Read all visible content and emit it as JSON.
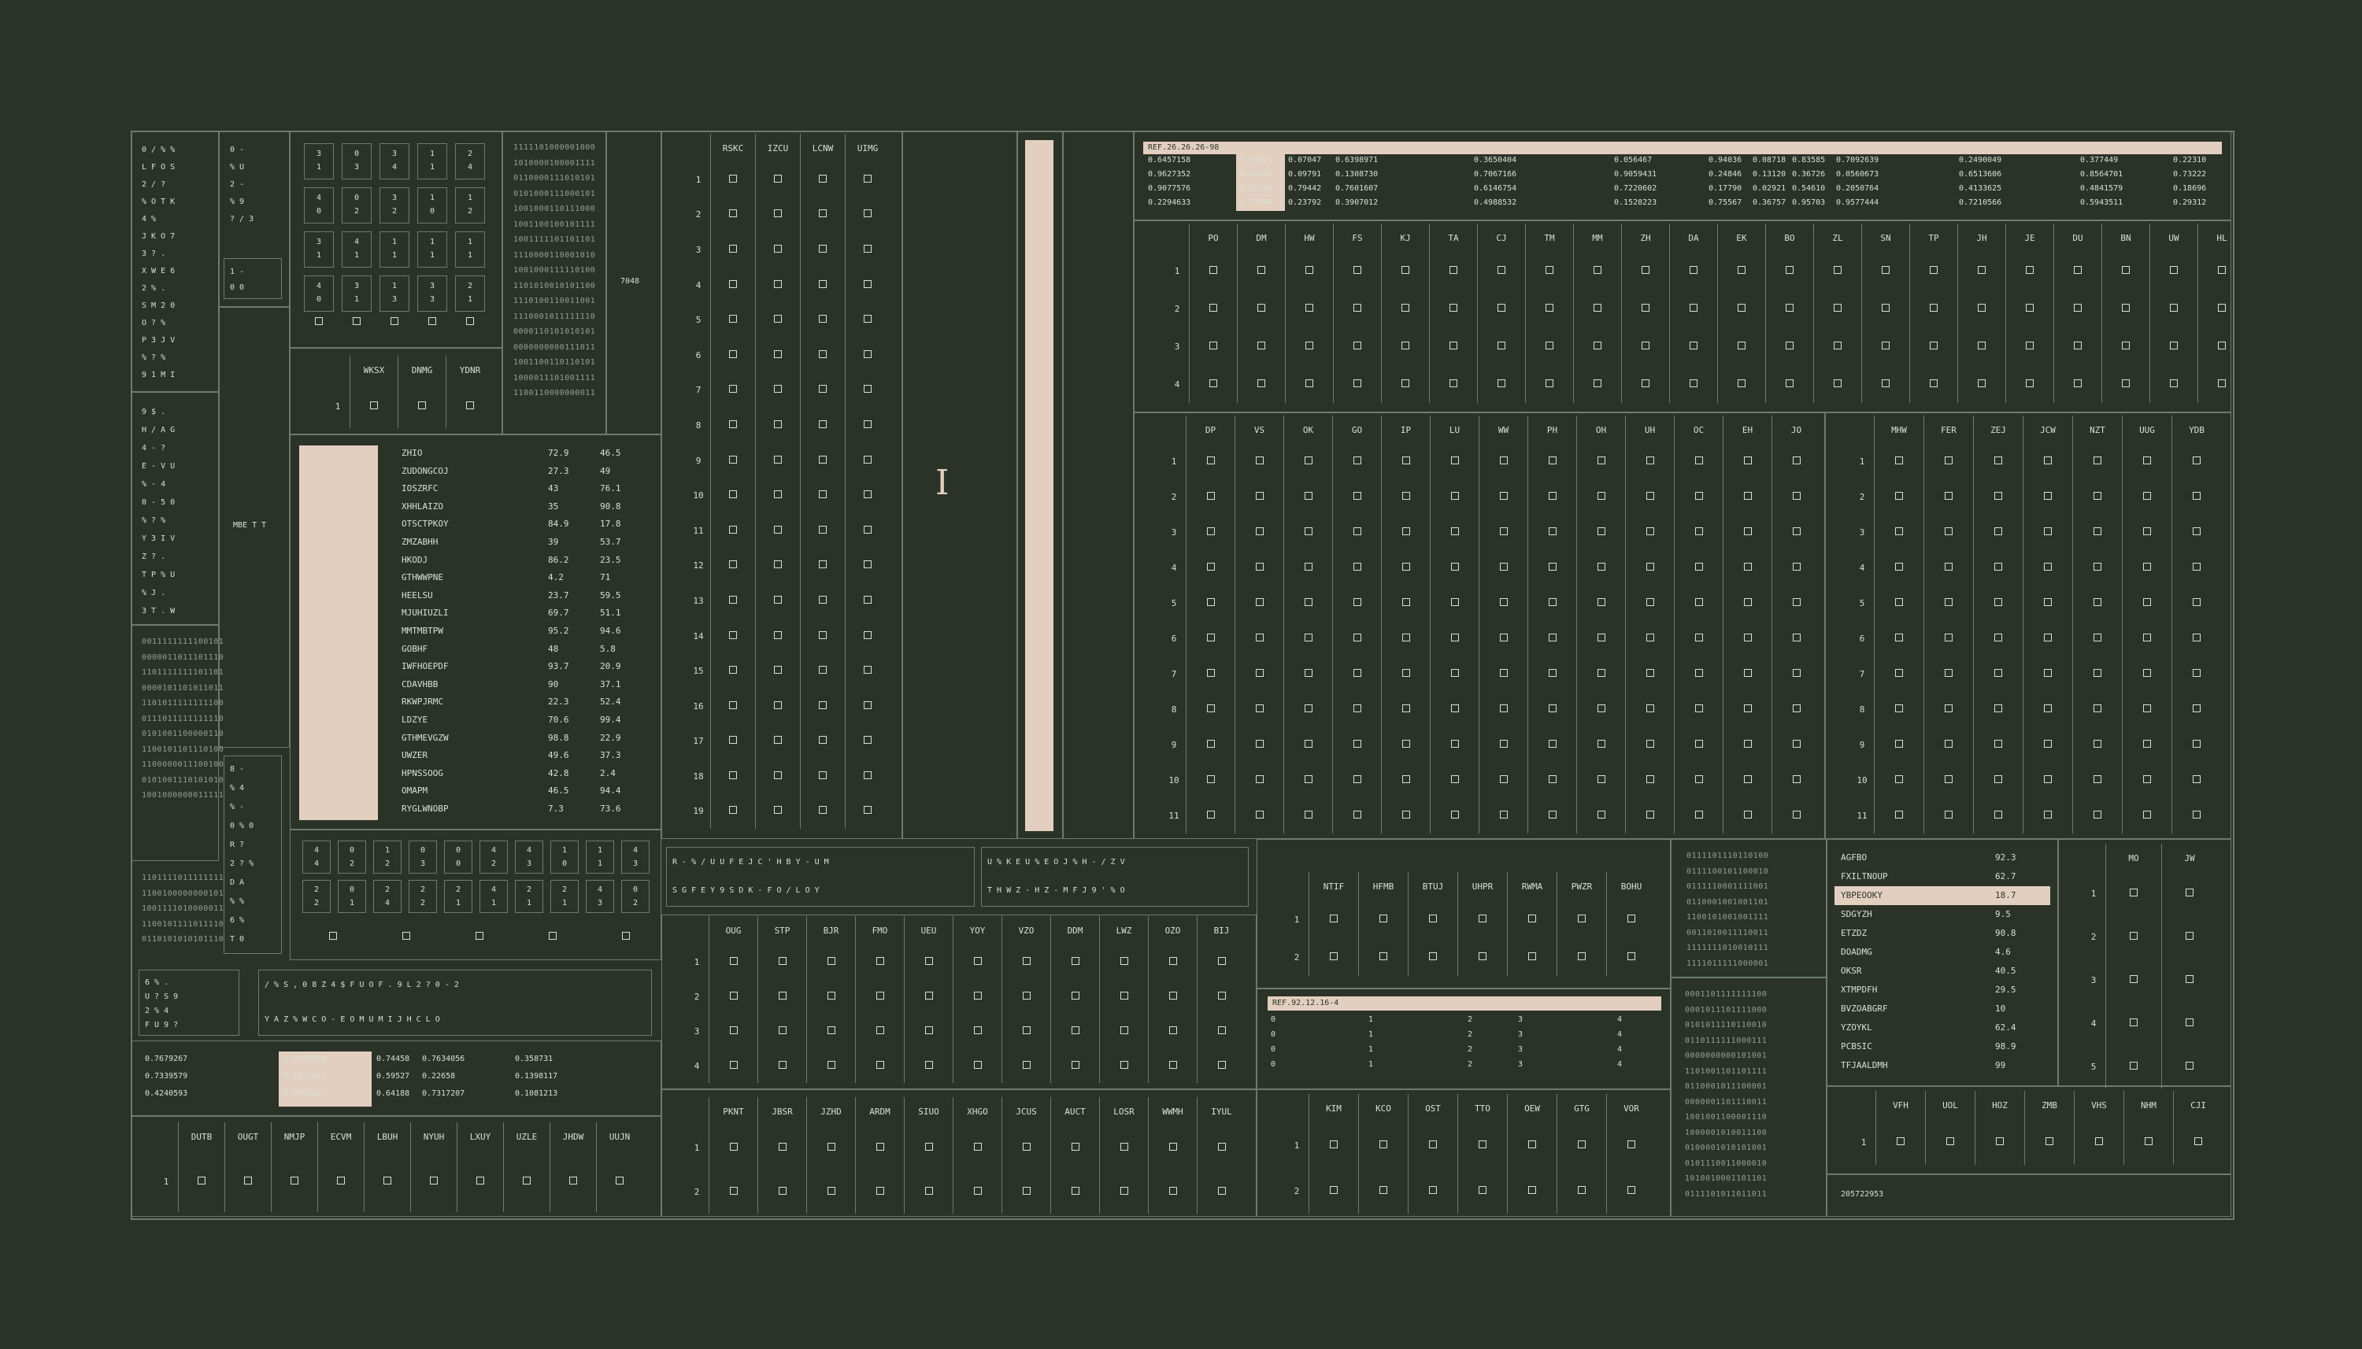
{
  "ref_top": "REF.26.26.26-98",
  "ref_mid": "REF.92.12.16-4",
  "left_label_mbe": "MBE T T",
  "left_number": "7048",
  "bottom_right_number": "205722953",
  "top_matrix": [
    [
      "0.6457158",
      "0.56071",
      "0.07047",
      "0.6398971",
      "0.3650404",
      "0.056467",
      "0.94036",
      "0.08718",
      "0.83585",
      "0.7092639",
      "0.2490049",
      "0.377449",
      "0.22310"
    ],
    [
      "0.9627352",
      "0.20302",
      "0.09791",
      "0.1308730",
      "0.7067166",
      "0.9059431",
      "0.24846",
      "0.13120",
      "0.36726",
      "0.0560673",
      "0.6513606",
      "0.8564701",
      "0.73222"
    ],
    [
      "0.9077576",
      "0.02646",
      "0.79442",
      "0.7601607",
      "0.6146754",
      "0.7220602",
      "0.17790",
      "0.02921",
      "0.54610",
      "0.2050764",
      "0.4133625",
      "0.4841579",
      "0.18696"
    ],
    [
      "0.2294633",
      "0.20506",
      "0.23792",
      "0.3907012",
      "0.4988532",
      "0.1528223",
      "0.75567",
      "0.36757",
      "0.95703",
      "0.9577444",
      "0.7210566",
      "0.5943511",
      "0.29312"
    ]
  ],
  "grid_top_right": {
    "cols": [
      "PO",
      "DM",
      "HW",
      "FS",
      "KJ",
      "TA",
      "CJ",
      "TM",
      "MM",
      "ZH",
      "DA",
      "EK",
      "BO",
      "ZL",
      "SN",
      "TP",
      "JH",
      "JE",
      "DU",
      "BN",
      "UW",
      "HL"
    ],
    "rows": [
      "1",
      "2",
      "3",
      "4"
    ]
  },
  "grid_mid_right_a": {
    "cols": [
      "DP",
      "VS",
      "OK",
      "GO",
      "IP",
      "LU",
      "WW",
      "PH",
      "OH",
      "UH",
      "OC",
      "EH",
      "JO"
    ],
    "rows": [
      "1",
      "2",
      "3",
      "4",
      "5",
      "6",
      "7",
      "8",
      "9",
      "10",
      "11"
    ]
  },
  "grid_mid_right_b": {
    "cols": [
      "MHW",
      "FER",
      "ZEJ",
      "JCW",
      "NZT",
      "UUG",
      "YDB"
    ],
    "rows": [
      "1",
      "2",
      "3",
      "4",
      "5",
      "6",
      "7",
      "8",
      "9",
      "10",
      "11"
    ]
  },
  "grid_center": {
    "cols": [
      "RSKC",
      "IZCU",
      "LCNW",
      "UIMG"
    ],
    "rows": [
      "1",
      "2",
      "3",
      "4",
      "5",
      "6",
      "7",
      "8",
      "9",
      "10",
      "11",
      "12",
      "13",
      "14",
      "15",
      "16",
      "17",
      "18",
      "19"
    ]
  },
  "grid_small_top": {
    "cols": [
      "WKSX",
      "DNMG",
      "YDNR"
    ],
    "rows": [
      "1"
    ]
  },
  "name_list": [
    {
      "name": "ZHIO",
      "a": "72.9",
      "b": "46.5"
    },
    {
      "name": "ZUDONGCOJ",
      "a": "27.3",
      "b": "49"
    },
    {
      "name": "IOSZRFC",
      "a": "43",
      "b": "76.1"
    },
    {
      "name": "XHHLAIZO",
      "a": "35",
      "b": "90.8"
    },
    {
      "name": "OTSCTPKOY",
      "a": "84.9",
      "b": "17.8"
    },
    {
      "name": "ZMZABHH",
      "a": "39",
      "b": "53.7"
    },
    {
      "name": "HKODJ",
      "a": "86.2",
      "b": "23.5"
    },
    {
      "name": "GTHWWPNE",
      "a": "4.2",
      "b": "71"
    },
    {
      "name": "HEELSU",
      "a": "23.7",
      "b": "59.5"
    },
    {
      "name": "MJUHIUZLI",
      "a": "69.7",
      "b": "51.1"
    },
    {
      "name": "MMTMBTPW",
      "a": "95.2",
      "b": "94.6"
    },
    {
      "name": "GOBHF",
      "a": "48",
      "b": "5.8"
    },
    {
      "name": "IWFHOEPDF",
      "a": "93.7",
      "b": "20.9"
    },
    {
      "name": "CDAVHBB",
      "a": "90",
      "b": "37.1"
    },
    {
      "name": "RKWPJRMC",
      "a": "22.3",
      "b": "52.4"
    },
    {
      "name": "LDZYE",
      "a": "70.6",
      "b": "99.4"
    },
    {
      "name": "GTHMEVGZW",
      "a": "98.8",
      "b": "22.9"
    },
    {
      "name": "UWZER",
      "a": "49.6",
      "b": "37.3"
    },
    {
      "name": "HPNSSOOG",
      "a": "42.8",
      "b": "2.4"
    },
    {
      "name": "OMAPM",
      "a": "46.5",
      "b": "94.4"
    },
    {
      "name": "RYGLWNOBP",
      "a": "7.3",
      "b": "73.6"
    }
  ],
  "right_list": [
    {
      "name": "AGFBO",
      "v": "92.3"
    },
    {
      "name": "FXILTNOUP",
      "v": "62.7"
    },
    {
      "name": "YBPEOOKY",
      "v": "18.7"
    },
    {
      "name": "SDGYZH",
      "v": "9.5"
    },
    {
      "name": "ETZDZ",
      "v": "90.8"
    },
    {
      "name": "DOADMG",
      "v": "4.6"
    },
    {
      "name": "OKSR",
      "v": "40.5"
    },
    {
      "name": "XTMPDFH",
      "v": "29.5"
    },
    {
      "name": "BVZOABGRF",
      "v": "10"
    },
    {
      "name": "YZOYKL",
      "v": "62.4"
    },
    {
      "name": "PCBSIC",
      "v": "98.9"
    },
    {
      "name": "TFJAALDMH",
      "v": "99"
    }
  ],
  "grid_mo_jw": {
    "cols": [
      "MO",
      "JW"
    ],
    "rows": [
      "1",
      "2",
      "3",
      "4",
      "5"
    ]
  },
  "grid_bottom_left": {
    "cols": [
      "DUTB",
      "OUGT",
      "NMJP",
      "ECVM",
      "LBUH",
      "NYUH",
      "LXUY",
      "UZLE",
      "JHDW",
      "UUJN"
    ],
    "rows": [
      "1"
    ]
  },
  "grid_bottom_mid_a": {
    "cols": [
      "OUG",
      "STP",
      "BJR",
      "FMO",
      "UEU",
      "YOY",
      "VZO",
      "DDM",
      "LWZ",
      "OZO",
      "BIJ"
    ],
    "rows": [
      "1",
      "2",
      "3",
      "4"
    ]
  },
  "grid_bottom_mid_b": {
    "cols": [
      "PKNT",
      "JBSR",
      "JZHD",
      "ARDM",
      "SIUO",
      "XHGO",
      "JCUS",
      "AUCT",
      "LOSR",
      "WWMH",
      "IYUL"
    ],
    "rows": [
      "1",
      "2"
    ]
  },
  "grid_ntif": {
    "cols": [
      "NTIF",
      "HFMB",
      "BTUJ",
      "UHPR",
      "RWMA",
      "PWZR",
      "BOHU"
    ],
    "rows": [
      "1",
      "2"
    ]
  },
  "grid_kim": {
    "cols": [
      "KIM",
      "KCO",
      "OST",
      "TTO",
      "OEW",
      "GTG",
      "VOR"
    ],
    "rows": [
      "1",
      "2"
    ]
  },
  "grid_vfh": {
    "cols": [
      "VFH",
      "UOL",
      "HOZ",
      "ZMB",
      "VHS",
      "NHM",
      "CJI"
    ],
    "rows": [
      "1"
    ]
  },
  "small_matrix_bl": [
    [
      "0.7679267",
      "0.8699509",
      "0.74458",
      "0.7634056",
      "0.358731"
    ],
    [
      "0.7339579",
      "0.1475527",
      "0.59527",
      "0.22658",
      "0.1398117"
    ],
    [
      "0.4240593",
      "0.983088",
      "0.64188",
      "0.7317207",
      "0.1081213"
    ]
  ],
  "ref_mid_rows": [
    [
      "0",
      "1",
      "2",
      "3",
      "4"
    ],
    [
      "0",
      "1",
      "2",
      "3",
      "4"
    ],
    [
      "0",
      "1",
      "2",
      "3",
      "4"
    ],
    [
      "0",
      "1",
      "2",
      "3",
      "4"
    ]
  ],
  "bits_a": [
    "1111101000001000",
    "1010000100001111",
    "0110000111010101",
    "0101000111000101",
    "1001000110111000",
    "1001100100101111",
    "1001111101101101",
    "1110000110001010",
    "1001000111110100",
    "1101010010101100",
    "1110100110011001",
    "1110001011111110",
    "0000110101010101",
    "0000000000111011",
    "1001100110110101",
    "1000011101001111",
    "1100110000000011"
  ],
  "bits_b": [
    "0011111111100101",
    "0000011011101110",
    "1101111111101101",
    "0000101101011011",
    "1101011111111100",
    "0111011111111110",
    "0101001100000110",
    "1100101101110100",
    "1100000011100100",
    "0101001110101010",
    "1001000000011111"
  ],
  "bits_c": [
    "1101111011111111",
    "1100100000000101",
    "1001111010000011",
    "1100101111011110",
    "0110101010101110"
  ],
  "bits_d": [
    "0111101110110100",
    "0111100101100010",
    "0111110001111001",
    "0110001001001101",
    "1100101001001111",
    "0011010011110011",
    "1111111010010111",
    "1111011111000001"
  ],
  "bits_e": [
    "0001101111111100",
    "0001011101111000",
    "0101011110110010",
    "0110111111000111",
    "0000000000101001",
    "1101001101101111",
    "0110001011100001",
    "0000001101110011",
    "1001001100001110",
    "1000001010011100",
    "0100001010101001",
    "0101110011000010",
    "1010010001101101",
    "0111101011011011"
  ],
  "digit_grid_top": [
    [
      "3",
      "1",
      "0",
      "3",
      "3",
      "4",
      "1",
      "1",
      "2",
      "4"
    ],
    [
      "4",
      "0",
      "0",
      "2",
      "3",
      "2",
      "1",
      "0",
      "1",
      "2"
    ],
    [
      "3",
      "1",
      "4",
      "1",
      "1",
      "1",
      "1",
      "1",
      "1",
      "1"
    ],
    [
      "4",
      "0",
      "3",
      "1",
      "1",
      "3",
      "3",
      "3",
      "2",
      "1"
    ]
  ],
  "digit_row_bottom": [
    [
      "4",
      "0",
      "1",
      "0",
      "0",
      "4",
      "4",
      "1",
      "1",
      "4"
    ],
    [
      "4",
      "2",
      "2",
      "3",
      "0",
      "2",
      "3",
      "0",
      "1",
      "3"
    ],
    [
      "2",
      "0",
      "2",
      "2",
      "2",
      "4",
      "2",
      "2",
      "4",
      "0"
    ],
    [
      "2",
      "1",
      "4",
      "2",
      "1",
      "1",
      "1",
      "1",
      "3",
      "2"
    ]
  ],
  "glyph_strip_a": "R - % / U U F E J C ' H B Y - U M",
  "glyph_strip_a2": "S G F E Y 9 S D K - F O / L O Y",
  "glyph_strip_b": "U % K E U % E O J % H - / Z V",
  "glyph_strip_b2": "T H W Z - H Z - M F J 9 ' % O",
  "glyph_strip_c": "/ % S , 0 8 Z 4 $ F U O F . 9 L 2 ? 0 - 2",
  "glyph_strip_c2": "Y A Z % W C O - E O M U M I J H C L O",
  "glyph_left_col": [
    "0 / % %",
    "L F O S",
    "2 / ?",
    "% O T K",
    "4 %",
    "J K O 7",
    "3 ? .",
    "X W E 6",
    "2 % .",
    "S M 2 0",
    "O ? %",
    "P 3 J V",
    "% ? %",
    "9 1 M I"
  ],
  "glyph_left_col_b": [
    "9 $ .",
    "H / A G",
    "4 - ?",
    "E - V U",
    "% - 4",
    "0 - 5 0",
    "% ? %",
    "Y 3 I V",
    "Z ? .",
    "T P % U",
    "% J .",
    "3 T . W"
  ],
  "glyph_mini": [
    "0 -",
    "% U",
    "2 -",
    "% 9",
    "? / 3"
  ],
  "glyph_mini_b": [
    "1 -",
    "0 0"
  ],
  "glyph_mini_c": [
    "8 -",
    "% 4",
    "% -",
    "0 % 0",
    "R ?",
    "2 ? %",
    "D A",
    "% %",
    "6 %",
    "T 0"
  ],
  "glyph_bl_box": [
    "6 % .",
    "U ? S 9",
    "2 % 4",
    "F U 9 ?"
  ]
}
